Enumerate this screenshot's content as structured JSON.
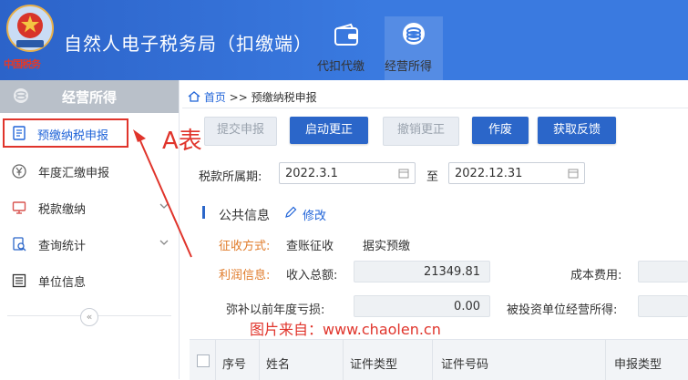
{
  "header": {
    "emblem_text": "中国税务",
    "title": "自然人电子税务局（扣缴端）",
    "nav": [
      {
        "label": "代扣代缴",
        "icon": "wallet-icon"
      },
      {
        "label": "经营所得",
        "icon": "coins-icon",
        "active": true
      }
    ]
  },
  "sidebar": {
    "title": "经营所得",
    "items": [
      {
        "label": "预缴纳税申报",
        "icon": "form-icon",
        "active": true
      },
      {
        "label": "年度汇缴申报",
        "icon": "yen-icon"
      },
      {
        "label": "税款缴纳",
        "icon": "monitor-icon",
        "expandable": true
      },
      {
        "label": "查询统计",
        "icon": "query-icon",
        "expandable": true
      },
      {
        "label": "单位信息",
        "icon": "list-icon"
      }
    ],
    "collapse_label": "«"
  },
  "breadcrumb": {
    "home": "首页",
    "sep": ">>",
    "current": "预缴纳税申报"
  },
  "toolbar": {
    "submit": "提交申报",
    "start_correct": "启动更正",
    "revoke_correct": "撤销更正",
    "void": "作废",
    "feedback": "获取反馈"
  },
  "annotation": "A表",
  "period": {
    "label": "税款所属期:",
    "start": "2022.3.1",
    "to": "至",
    "end": "2022.12.31"
  },
  "public_info": {
    "title": "公共信息",
    "edit": "修改",
    "collect_label": "征收方式:",
    "collect_value1": "查账征收",
    "collect_value2": "据实预缴",
    "profit_label": "利润信息:",
    "income_label": "收入总额:",
    "income_value": "21349.81",
    "cost_label": "成本费用:",
    "loss_label": "弥补以前年度亏损:",
    "loss_value": "0.00",
    "invest_label": "被投资单位经营所得:"
  },
  "watermark": "图片来自：www.chaolen.cn",
  "table": {
    "columns": [
      "序号",
      "姓名",
      "证件类型",
      "证件号码",
      "申报类型"
    ]
  },
  "colors": {
    "header_blue": "#3a7ae0",
    "primary": "#2b66c9",
    "annotation_red": "#e0342b",
    "orange": "#e07b2a"
  }
}
